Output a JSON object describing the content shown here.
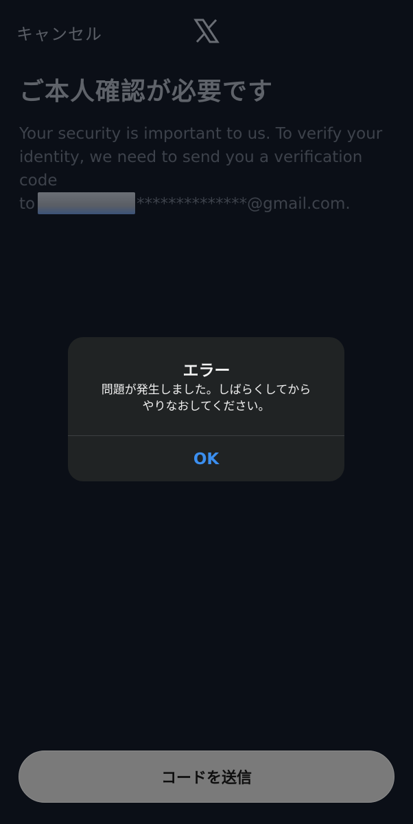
{
  "header": {
    "cancel_label": "キャンセル",
    "logo_icon": "x-logo-icon"
  },
  "main": {
    "title": "ご本人確認が必要です",
    "description_line1": "Your security is important to us. To verify your",
    "description_line2": "identity, we need to send you a verification code",
    "description_prefix": "to",
    "email_masked_suffix": "**************@gmail.com."
  },
  "alert": {
    "title": "エラー",
    "message_line1": "問題が発生しました。しばらくしてから",
    "message_line2": "やりなおしてください。",
    "ok_label": "OK"
  },
  "footer": {
    "send_code_label": "コードを送信"
  },
  "colors": {
    "background": "#0b0f17",
    "alert_background": "#202324",
    "ok_blue": "#3b8ff0",
    "button_gray": "#7a7a7a"
  }
}
